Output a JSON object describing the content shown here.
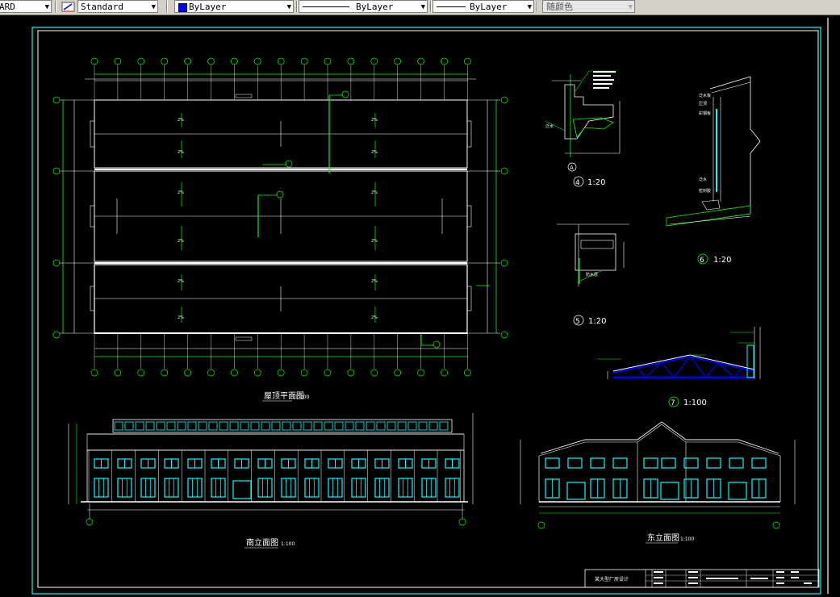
{
  "toolbar": {
    "textstyle_partial": "ARD",
    "dimstyle_value": "Standard",
    "color_value": "ByLayer",
    "linetype_value": "ByLayer",
    "lineweight_value": "ByLayer",
    "plotstyle_value": "随颜色",
    "colors": {
      "swatch": "#0000ff"
    }
  },
  "drawing": {
    "roof_plan_title": "屋顶平面图",
    "roof_plan_scale": "1:100",
    "south_elevation_title": "南立面图",
    "south_elevation_scale": "1:100",
    "east_elevation_title": "东立面图",
    "east_elevation_scale": "1:100",
    "detail4_label": "1:20",
    "detail4_num": "4",
    "detail5_label": "1:20",
    "detail5_num": "5",
    "detail6_label": "1:20",
    "detail6_num": "6",
    "detail7_label": "1:100",
    "detail7_num": "7",
    "grid_axis_a": "A",
    "title_block_name": "某大型厂房设计",
    "colors": {
      "cyan": "#00ffff",
      "green": "#00ff00",
      "white": "#ffffff",
      "blue": "#0000ff"
    }
  }
}
